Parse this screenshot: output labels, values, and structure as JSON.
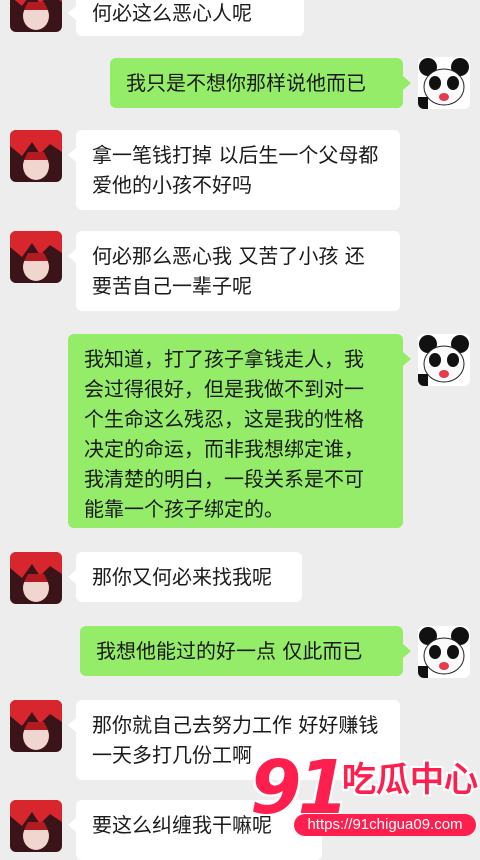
{
  "messages": [
    {
      "side": "left",
      "text": "何必这么恶心人呢"
    },
    {
      "side": "right",
      "text": "我只是不想你那样说他而已"
    },
    {
      "side": "left",
      "text": "拿一笔钱打掉 以后生一个父母都\n爱他的小孩不好吗"
    },
    {
      "side": "left",
      "text": "何必那么恶心我 又苦了小孩 还\n要苦自己一辈子呢"
    },
    {
      "side": "right",
      "text": "我知道，打了孩子拿钱走人，我\n会过得很好，但是我做不到对一\n个生命这么残忍，这是我的性格\n决定的命运，而非我想绑定谁，\n我清楚的明白，一段关系是不可\n能靠一个孩子绑定的。"
    },
    {
      "side": "left",
      "text": "那你又何必来找我呢"
    },
    {
      "side": "right",
      "text": "我想他能过的好一点 仅此而已"
    },
    {
      "side": "left",
      "text": "那你就自己去努力工作 好好赚钱\n一天多打几份工啊"
    },
    {
      "side": "left",
      "text": "要这么纠缠我干嘛呢"
    }
  ],
  "avatars": {
    "left": {
      "icon": "red-hair-anime-avatar-icon"
    },
    "right": {
      "icon": "panda-cartoon-avatar-icon"
    }
  },
  "watermark": {
    "logo_number": "91",
    "logo_text": "吃瓜中心",
    "url": "https://91chigua09.com"
  },
  "colors": {
    "background": "#ededed",
    "bubble_left": "#ffffff",
    "bubble_right": "#95ec69",
    "watermark": "#ff1f4e"
  }
}
